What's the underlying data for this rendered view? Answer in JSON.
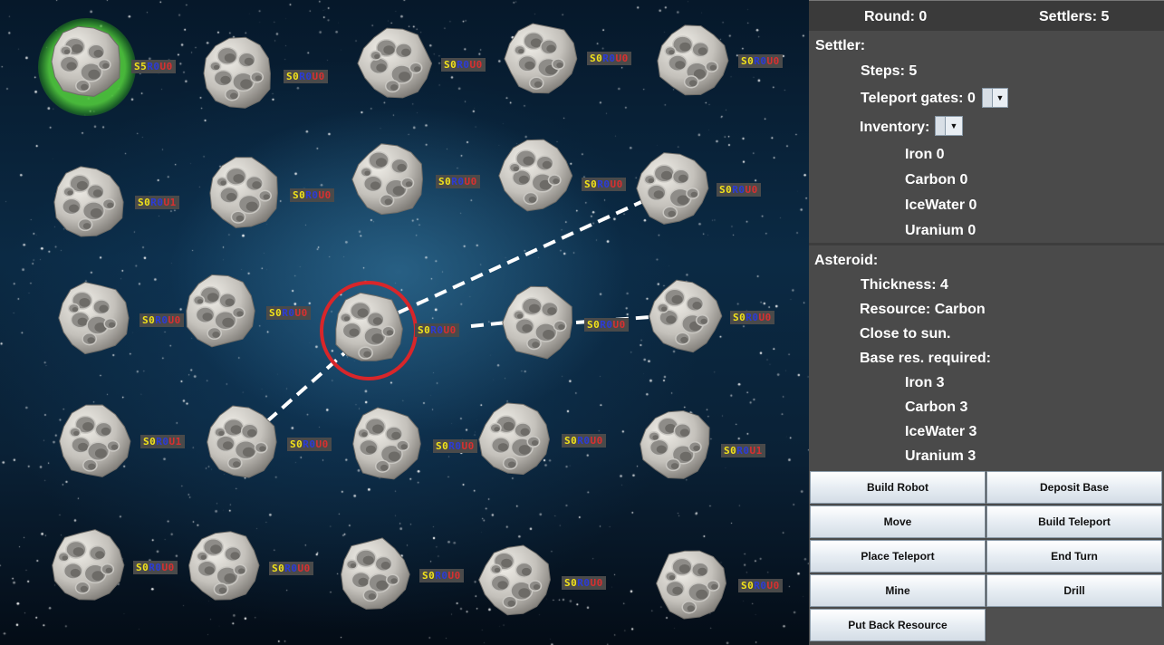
{
  "colors": {
    "panel_bg": "#4a4a4a",
    "tag_bg": "#4a4a4a",
    "settler_count": "#f2e21a",
    "robot_count": "#2b3bd8",
    "ufo_count": "#d83030",
    "selection_ring": "#d8262a",
    "settler_highlight": "#4fc83c",
    "teleport_link": "#ffffff"
  },
  "board": {
    "asteroids": [
      {
        "label": "S5R0U0",
        "s": "S5",
        "r": "R0",
        "u": "U0",
        "selected_settler": true
      },
      {
        "label": "S0R0U0",
        "s": "S0",
        "r": "R0",
        "u": "U0"
      },
      {
        "label": "S0R0U0",
        "s": "S0",
        "r": "R0",
        "u": "U0"
      },
      {
        "label": "S0R0U0",
        "s": "S0",
        "r": "R0",
        "u": "U0"
      },
      {
        "label": "S0R0U0",
        "s": "S0",
        "r": "R0",
        "u": "U0"
      },
      {
        "label": "S0R0U1",
        "s": "S0",
        "r": "R0",
        "u": "U1"
      },
      {
        "label": "S0R0U0",
        "s": "S0",
        "r": "R0",
        "u": "U0"
      },
      {
        "label": "S0R0U0",
        "s": "S0",
        "r": "R0",
        "u": "U0"
      },
      {
        "label": "S0R0U0",
        "s": "S0",
        "r": "R0",
        "u": "U0"
      },
      {
        "label": "S0R0U0",
        "s": "S0",
        "r": "R0",
        "u": "U0"
      },
      {
        "label": "S0R0U0",
        "s": "S0",
        "r": "R0",
        "u": "U0"
      },
      {
        "label": "S0R0U0",
        "s": "S0",
        "r": "R0",
        "u": "U0"
      },
      {
        "label": "S0R0U0",
        "s": "S0",
        "r": "R0",
        "u": "U0",
        "selected_asteroid": true
      },
      {
        "label": "S0R0U0",
        "s": "S0",
        "r": "R0",
        "u": "U0"
      },
      {
        "label": "S0R0U0",
        "s": "S0",
        "r": "R0",
        "u": "U0"
      },
      {
        "label": "S0R0U1",
        "s": "S0",
        "r": "R0",
        "u": "U1"
      },
      {
        "label": "S0R0U0",
        "s": "S0",
        "r": "R0",
        "u": "U0"
      },
      {
        "label": "S0R0U0",
        "s": "S0",
        "r": "R0",
        "u": "U0"
      },
      {
        "label": "S0R0U0",
        "s": "S0",
        "r": "R0",
        "u": "U0"
      },
      {
        "label": "S0R0U1",
        "s": "S0",
        "r": "R0",
        "u": "U1"
      },
      {
        "label": "S0R0U0",
        "s": "S0",
        "r": "R0",
        "u": "U0"
      },
      {
        "label": "S0R0U0",
        "s": "S0",
        "r": "R0",
        "u": "U0"
      },
      {
        "label": "S0R0U0",
        "s": "S0",
        "r": "R0",
        "u": "U0"
      },
      {
        "label": "S0R0U0",
        "s": "S0",
        "r": "R0",
        "u": "U0"
      },
      {
        "label": "S0R0U0",
        "s": "S0",
        "r": "R0",
        "u": "U0"
      }
    ]
  },
  "panel": {
    "round_label": "Round: 0",
    "settlers_label": "Settlers: 5",
    "settler": {
      "heading": "Settler:",
      "steps": "Steps: 5",
      "teleport_gates": "Teleport gates: 0",
      "inventory": "Inventory:",
      "items": [
        "Iron 0",
        "Carbon 0",
        "IceWater 0",
        "Uranium 0"
      ]
    },
    "asteroid": {
      "heading": "Asteroid:",
      "thickness": "Thickness: 4",
      "resource": "Resource: Carbon",
      "sun_status": "Close to sun.",
      "base_required": "Base res. required:",
      "items": [
        "Iron 3",
        "Carbon 3",
        "IceWater 3",
        "Uranium 3"
      ]
    },
    "buttons": {
      "build_robot": "Build Robot",
      "deposit_base": "Deposit Base",
      "move": "Move",
      "build_teleport": "Build Teleport",
      "place_teleport": "Place Teleport",
      "end_turn": "End Turn",
      "mine": "Mine",
      "drill": "Drill",
      "put_back_resource": "Put Back Resource"
    }
  }
}
